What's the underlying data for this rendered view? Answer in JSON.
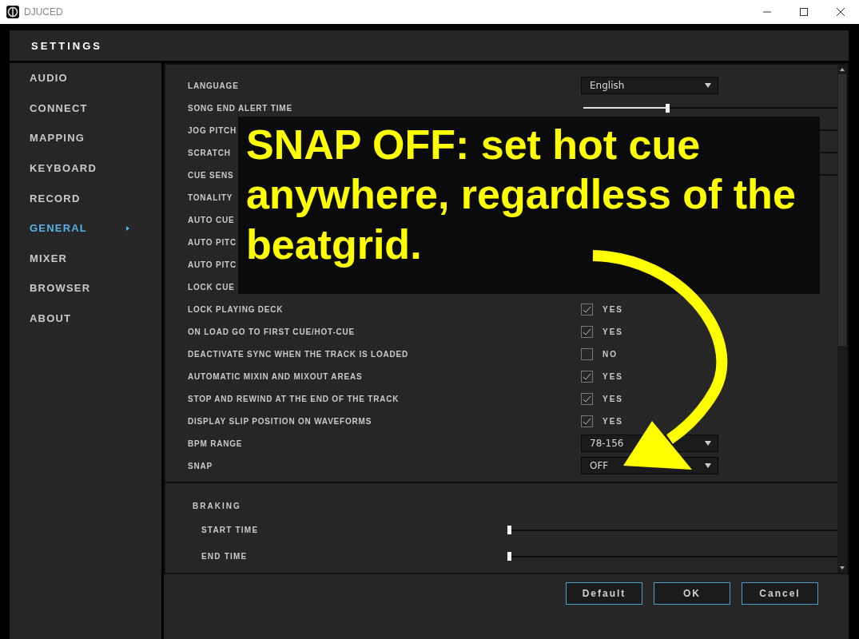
{
  "window": {
    "title": "DJUCED"
  },
  "header": {
    "title": "SETTINGS"
  },
  "sidebar": {
    "items": [
      {
        "label": "AUDIO",
        "selected": false
      },
      {
        "label": "CONNECT",
        "selected": false
      },
      {
        "label": "MAPPING",
        "selected": false
      },
      {
        "label": "KEYBOARD",
        "selected": false
      },
      {
        "label": "RECORD",
        "selected": false
      },
      {
        "label": "GENERAL",
        "selected": true
      },
      {
        "label": "MIXER",
        "selected": false
      },
      {
        "label": "BROWSER",
        "selected": false
      },
      {
        "label": "ABOUT",
        "selected": false
      }
    ]
  },
  "settings": [
    {
      "kind": "dropdown",
      "label": "LANGUAGE",
      "value": "English"
    },
    {
      "kind": "slider",
      "label": "SONG END ALERT TIME",
      "level": 0.33
    },
    {
      "kind": "slider",
      "label": "JOG PITCH"
    },
    {
      "kind": "slider",
      "label": "SCRATCH"
    },
    {
      "kind": "slider",
      "label": "CUE SENS"
    },
    {
      "kind": "label",
      "label": "TONALITY"
    },
    {
      "kind": "label",
      "label": "AUTO CUE"
    },
    {
      "kind": "label",
      "label": "AUTO PITC"
    },
    {
      "kind": "label",
      "label": "AUTO PITC"
    },
    {
      "kind": "label",
      "label": "LOCK CUE"
    },
    {
      "kind": "checkbox",
      "label": "LOCK PLAYING DECK",
      "checked": true,
      "value": "YES"
    },
    {
      "kind": "checkbox",
      "label": "ON LOAD GO TO FIRST CUE/HOT-CUE",
      "checked": true,
      "value": "YES"
    },
    {
      "kind": "checkbox",
      "label": "DEACTIVATE SYNC WHEN THE TRACK IS LOADED",
      "checked": false,
      "value": "NO"
    },
    {
      "kind": "checkbox",
      "label": "AUTOMATIC MIXIN AND MIXOUT AREAS",
      "checked": true,
      "value": "YES"
    },
    {
      "kind": "checkbox",
      "label": "STOP AND REWIND AT THE END OF THE TRACK",
      "checked": true,
      "value": "YES"
    },
    {
      "kind": "checkbox",
      "label": "DISPLAY SLIP POSITION ON WAVEFORMS",
      "checked": true,
      "value": "YES"
    },
    {
      "kind": "dropdown",
      "label": "BPM RANGE",
      "value": "78-156"
    },
    {
      "kind": "dropdown",
      "label": "SNAP",
      "value": "OFF"
    }
  ],
  "braking": {
    "title": "BRAKING",
    "sliders": [
      {
        "label": "START TIME",
        "level": 0
      },
      {
        "label": "END TIME",
        "level": 0
      }
    ]
  },
  "buttons": [
    "Default",
    "OK",
    "Cancel"
  ],
  "annotation": {
    "text": "SNAP OFF: set hot cue anywhere, regardless of the beatgrid."
  }
}
